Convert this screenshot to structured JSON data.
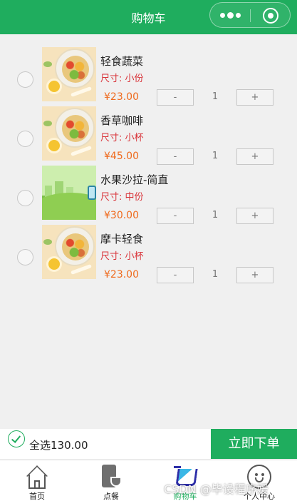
{
  "header": {
    "title": "购物车"
  },
  "capsule": {
    "more_icon": "more-dots-icon",
    "close_icon": "target-icon"
  },
  "cart": {
    "items": [
      {
        "name": "轻食蔬菜",
        "size": "尺寸: 小份",
        "price": "¥23.00",
        "qty": "1",
        "minus": "-",
        "plus": "+",
        "image": "food-bowl-image"
      },
      {
        "name": "香草咖啡",
        "size": "尺寸: 小杯",
        "price": "¥45.00",
        "qty": "1",
        "minus": "-",
        "plus": "+",
        "image": "food-bowl-image"
      },
      {
        "name": "水果沙拉-简直",
        "size": "尺寸: 中份",
        "price": "¥30.00",
        "qty": "1",
        "minus": "-",
        "plus": "+",
        "image": "green-landscape-image"
      },
      {
        "name": "摩卡轻食",
        "size": "尺寸: 小杯",
        "price": "¥23.00",
        "qty": "1",
        "minus": "-",
        "plus": "+",
        "image": "food-bowl-image"
      }
    ]
  },
  "footer": {
    "select_all": "全选130.00",
    "order_button": "立即下单"
  },
  "tabbar": {
    "tabs": [
      {
        "label": "首页",
        "icon": "home-icon"
      },
      {
        "label": "点餐",
        "icon": "order-icon"
      },
      {
        "label": "购物车",
        "icon": "cart-icon"
      },
      {
        "label": "个人中心",
        "icon": "profile-icon"
      }
    ],
    "active_color": "#1fad5e"
  },
  "watermark": "CSDN @毕设程序媛",
  "colors": {
    "brand": "#1fad5e",
    "price": "#ef6a1d",
    "size": "#d9343a"
  }
}
